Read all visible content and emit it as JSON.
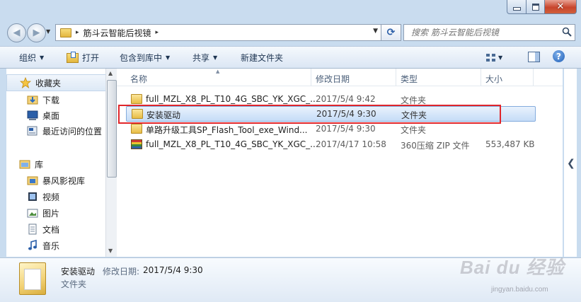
{
  "window": {
    "caption_close": "✕"
  },
  "address_bar": {
    "path": "筋斗云智能后视镜",
    "separator": "▸"
  },
  "search": {
    "placeholder": "搜索 筋斗云智能后视镜"
  },
  "toolbar": {
    "organize": "组织",
    "open": "打开",
    "include_in_library": "包含到库中",
    "share": "共享",
    "new_folder": "新建文件夹",
    "help": "?"
  },
  "nav": {
    "favorites": {
      "label": "收藏夹",
      "items": [
        {
          "label": "下载",
          "icon": "download-folder-icon"
        },
        {
          "label": "桌面",
          "icon": "desktop-icon"
        },
        {
          "label": "最近访问的位置",
          "icon": "recent-places-icon"
        }
      ]
    },
    "libraries": {
      "label": "库",
      "items": [
        {
          "label": "暴风影视库",
          "icon": "video-library-icon"
        },
        {
          "label": "视频",
          "icon": "video-icon"
        },
        {
          "label": "图片",
          "icon": "picture-icon"
        },
        {
          "label": "文档",
          "icon": "document-icon"
        },
        {
          "label": "音乐",
          "icon": "music-icon"
        }
      ]
    }
  },
  "columns": {
    "name": "名称",
    "date_modified": "修改日期",
    "type": "类型",
    "size": "大小"
  },
  "files": [
    {
      "name": "full_MZL_X8_PL_T10_4G_SBC_YK_XGC_...",
      "date": "2017/5/4 9:42",
      "type": "文件夹",
      "size": "",
      "icon": "folder-icon",
      "selected": false
    },
    {
      "name": "安装驱动",
      "date": "2017/5/4 9:30",
      "type": "文件夹",
      "size": "",
      "icon": "folder-icon",
      "selected": true
    },
    {
      "name": "单路升级工具SP_Flash_Tool_exe_Wind...",
      "date": "2017/5/4 9:30",
      "type": "文件夹",
      "size": "",
      "icon": "folder-icon",
      "selected": false
    },
    {
      "name": "full_MZL_X8_PL_T10_4G_SBC_YK_XGC_...",
      "date": "2017/4/17 10:58",
      "type": "360压缩 ZIP 文件",
      "size": "553,487 KB",
      "icon": "zip-archive-icon",
      "selected": false
    }
  ],
  "details": {
    "name": "安装驱动",
    "date_label": "修改日期:",
    "date": "2017/5/4 9:30",
    "type": "文件夹"
  },
  "watermark": {
    "text": "Bai du 经验",
    "sub": "jingyan.baidu.com"
  }
}
